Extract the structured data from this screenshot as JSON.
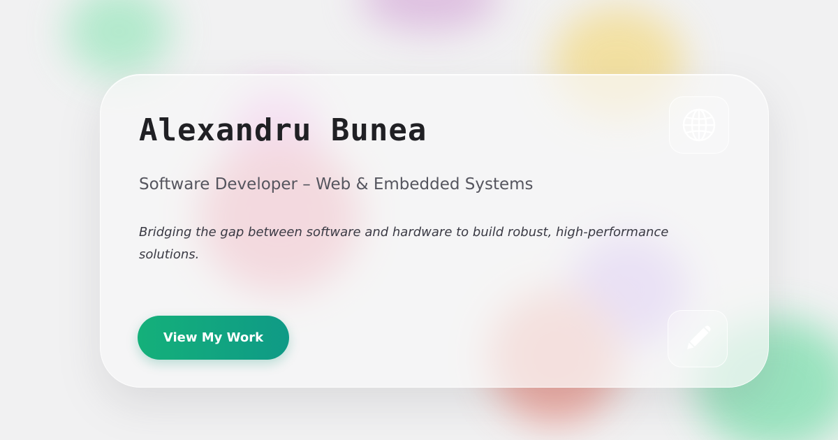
{
  "profile": {
    "name": "Alexandru Bunea",
    "role": "Software Developer – Web & Embedded Systems",
    "tagline": "Bridging the gap between software and hardware to build robust, high-performance solutions."
  },
  "actions": {
    "cta_label": "View My Work",
    "top_icon": "globe-icon",
    "bottom_icon": "pencil-icon"
  },
  "colors": {
    "accent_start": "#14b07a",
    "accent_end": "#0f9a86",
    "text_dark": "#202024",
    "background": "#f1f1f2"
  }
}
